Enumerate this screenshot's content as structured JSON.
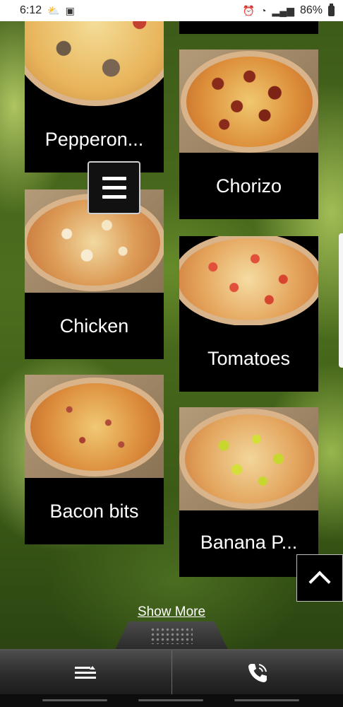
{
  "status_bar": {
    "time": "6:12",
    "battery": "86%"
  },
  "menu_items": [
    {
      "label": "Pepperon..."
    },
    {
      "label": "Chorizo"
    },
    {
      "label": "Chicken"
    },
    {
      "label": "Tomatoes"
    },
    {
      "label": "Bacon bits"
    },
    {
      "label": "Banana P..."
    }
  ],
  "show_more": "Show More",
  "colors": {
    "card_bg": "#000000",
    "label_text": "#ffffff"
  }
}
